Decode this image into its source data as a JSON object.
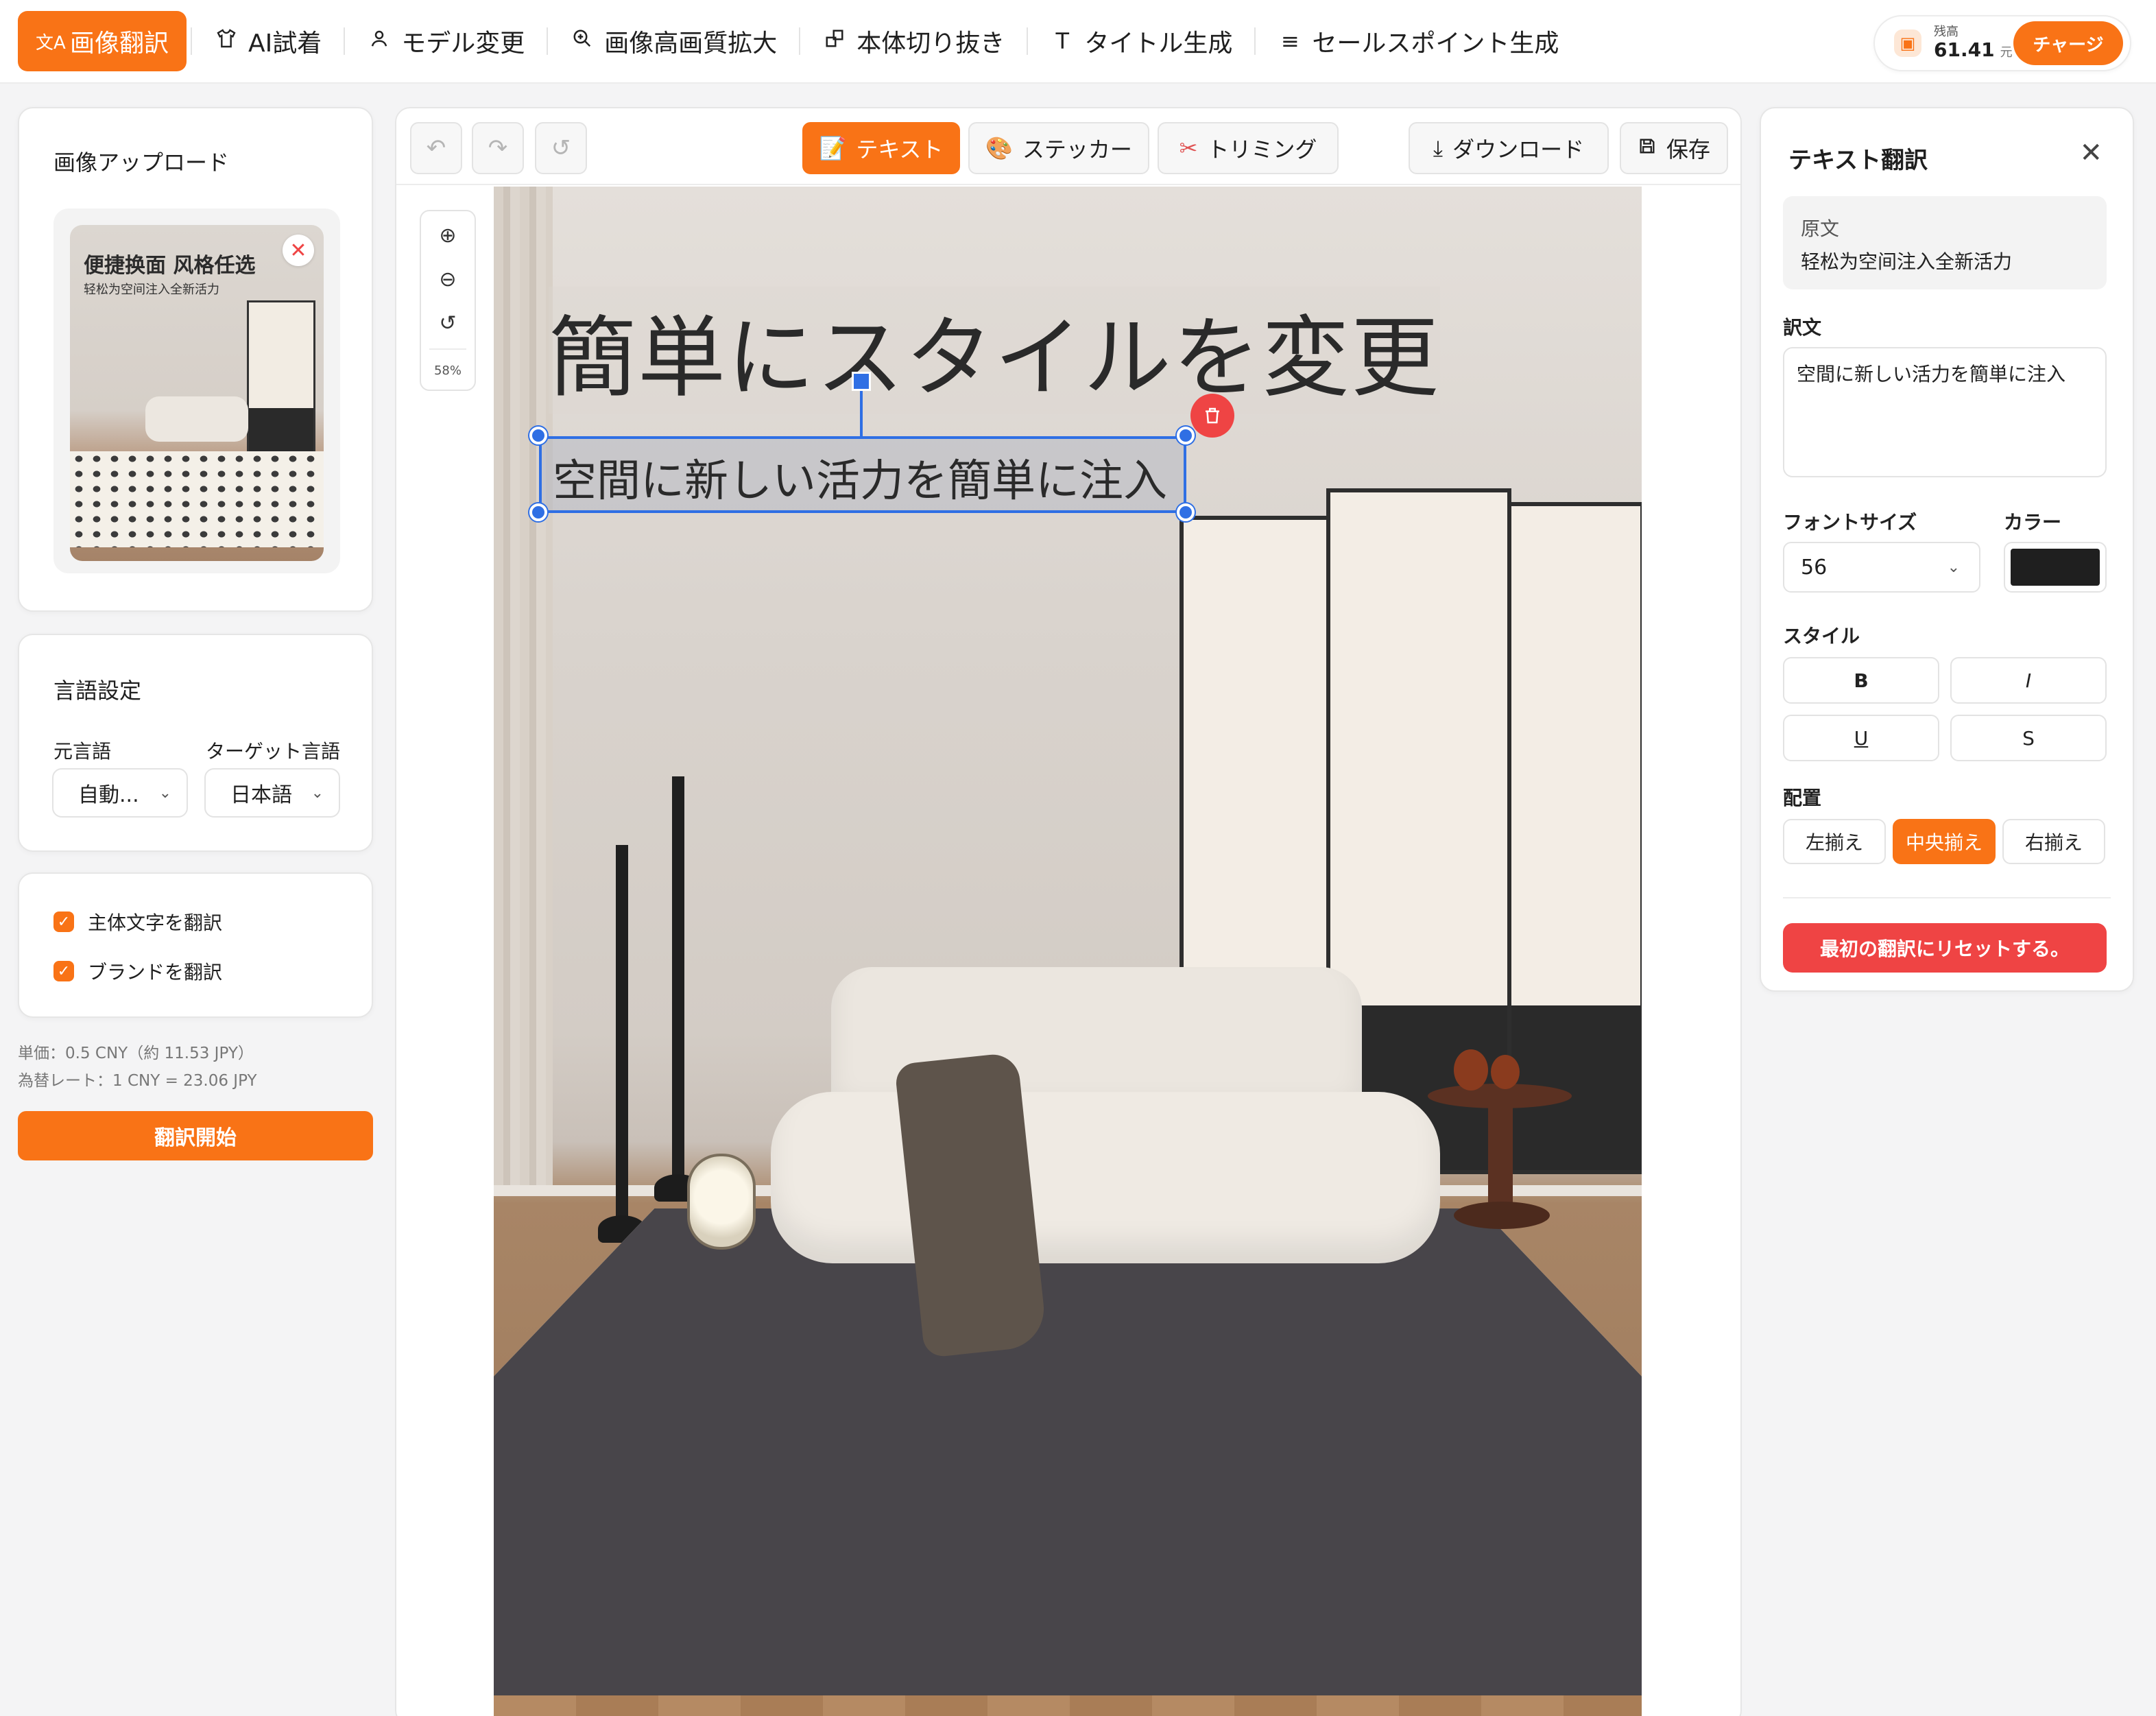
{
  "nav": {
    "items": [
      {
        "label": "画像翻訳",
        "icon": "translate-icon",
        "glyph": "文A"
      },
      {
        "label": "AI試着",
        "icon": "shirt-icon",
        "glyph": "👕"
      },
      {
        "label": "モデル変更",
        "icon": "person-icon",
        "glyph": "♙"
      },
      {
        "label": "画像高画質拡大",
        "icon": "zoom-enhance-icon",
        "glyph": "⊕"
      },
      {
        "label": "本体切り抜き",
        "icon": "cutout-icon",
        "glyph": "⧉"
      },
      {
        "label": "タイトル生成",
        "icon": "text-t-icon",
        "glyph": "T"
      },
      {
        "label": "セールスポイント生成",
        "icon": "list-icon",
        "glyph": "≡"
      }
    ]
  },
  "balance": {
    "label": "残高",
    "amount": "61.41",
    "unit": "元",
    "charge_label": "チャージ"
  },
  "upload": {
    "title": "画像アップロード",
    "thumb_title": "便捷换面 风格任选",
    "thumb_subtitle": "轻松为空间注入全新活力",
    "remove_glyph": "✕"
  },
  "language": {
    "title": "言語設定",
    "source_label": "元言語",
    "source_value": "自動...",
    "target_label": "ターゲット言語",
    "target_value": "日本語"
  },
  "options": {
    "translate_main": "主体文字を翻訳",
    "translate_brand": "ブランドを翻訳"
  },
  "pricing": {
    "unit_price": "単価：0.5 CNY（約 11.53 JPY）",
    "rate": "為替レート：1 CNY = 23.06 JPY",
    "start_label": "翻訳開始"
  },
  "toolbar": {
    "undo_glyph": "↶",
    "redo_glyph": "↷",
    "reset_glyph": "↺",
    "text_label": "テキスト",
    "text_icon": "📝",
    "sticker_label": "ステッカー",
    "sticker_icon": "🎨",
    "trim_label": "トリミング",
    "trim_icon": "✂",
    "download_label": "ダウンロード",
    "download_icon": "⤓",
    "save_label": "保存",
    "save_icon": "💾"
  },
  "zoom": {
    "zoom_in": "⊕",
    "zoom_out": "⊖",
    "reset": "↺",
    "level": "58%"
  },
  "canvas": {
    "headline": "簡単にスタイルを変更",
    "subline": "空間に新しい活力を簡単に注入",
    "delete_glyph": "🗑"
  },
  "text_panel": {
    "title": "テキスト翻訳",
    "close_glyph": "✕",
    "original_label": "原文",
    "original_text": "轻松为空间注入全新活力",
    "translation_label": "訳文",
    "translation_text": "空間に新しい活力を簡単に注入",
    "font_size_label": "フォントサイズ",
    "font_size_value": "56",
    "color_label": "カラー",
    "color_value": "#1f1f1f",
    "style_label": "スタイル",
    "bold": "B",
    "italic": "I",
    "underline": "U",
    "strike": "S",
    "align_label": "配置",
    "align_left": "左揃え",
    "align_center": "中央揃え",
    "align_right": "右揃え",
    "reset_label": "最初の翻訳にリセットする。"
  },
  "colors": {
    "accent": "#f97316",
    "danger": "#ef4444",
    "selection": "#2f6fe4"
  }
}
